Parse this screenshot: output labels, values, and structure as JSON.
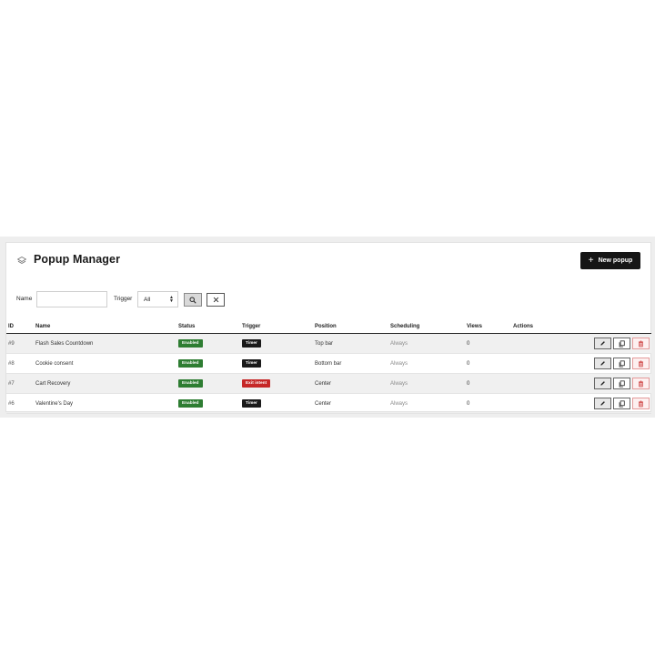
{
  "header": {
    "title": "Popup Manager",
    "new_button_label": "New popup",
    "new_button_icon": "plus"
  },
  "filters": {
    "name_label": "Name",
    "name_value": "",
    "trigger_label": "Trigger",
    "trigger_selected": "All",
    "search_icon": "search-icon",
    "clear_icon": "close-icon"
  },
  "table": {
    "columns": [
      "ID",
      "Name",
      "Status",
      "Trigger",
      "Position",
      "Scheduling",
      "Views",
      "Actions"
    ],
    "rows": [
      {
        "id": "#9",
        "name": "Flash Sales Countdown",
        "status": "Enabled",
        "trigger": "Timer",
        "position": "Top bar",
        "scheduling": "Always",
        "views": "0"
      },
      {
        "id": "#8",
        "name": "Cookie consent",
        "status": "Enabled",
        "trigger": "Timer",
        "position": "Bottom bar",
        "scheduling": "Always",
        "views": "0"
      },
      {
        "id": "#7",
        "name": "Cart Recovery",
        "status": "Enabled",
        "trigger": "Exit intent",
        "position": "Center",
        "scheduling": "Always",
        "views": "0"
      },
      {
        "id": "#6",
        "name": "Valentine's Day",
        "status": "Enabled",
        "trigger": "Timer",
        "position": "Center",
        "scheduling": "Always",
        "views": "0"
      }
    ]
  },
  "colors": {
    "enabled_badge": "#2e7d32",
    "timer_badge": "#1a1a1a",
    "exit_intent_badge": "#c62828",
    "primary_button": "#161616"
  }
}
